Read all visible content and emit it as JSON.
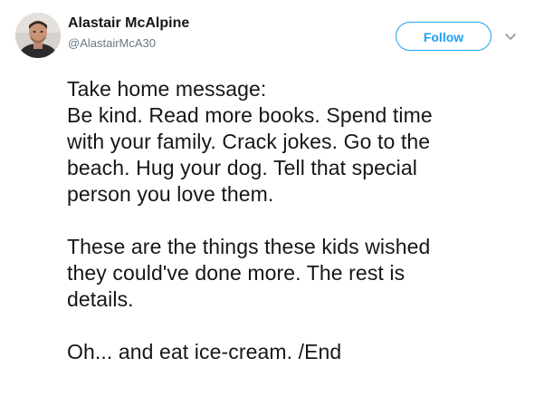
{
  "author": {
    "name": "Alastair McAlpine",
    "handle": "@AlastairMcA30",
    "avatar_icon": "profile-photo"
  },
  "actions": {
    "follow_label": "Follow",
    "more_icon": "chevron-down-icon"
  },
  "colors": {
    "accent": "#1da1f2",
    "text": "#14171a",
    "secondary_text": "#657786"
  },
  "tweet": {
    "lines": {
      "l1": "Take home message:",
      "l2": "Be kind. Read more books. Spend time",
      "l3": "with your family. Crack jokes. Go to the",
      "l4": "beach. Hug your dog. Tell that special",
      "l5": "person you love them.",
      "l6": "These are the things these kids wished",
      "l7": "they could've done more. The rest is",
      "l8": "details.",
      "l9": "Oh... and eat ice-cream. /End"
    }
  }
}
